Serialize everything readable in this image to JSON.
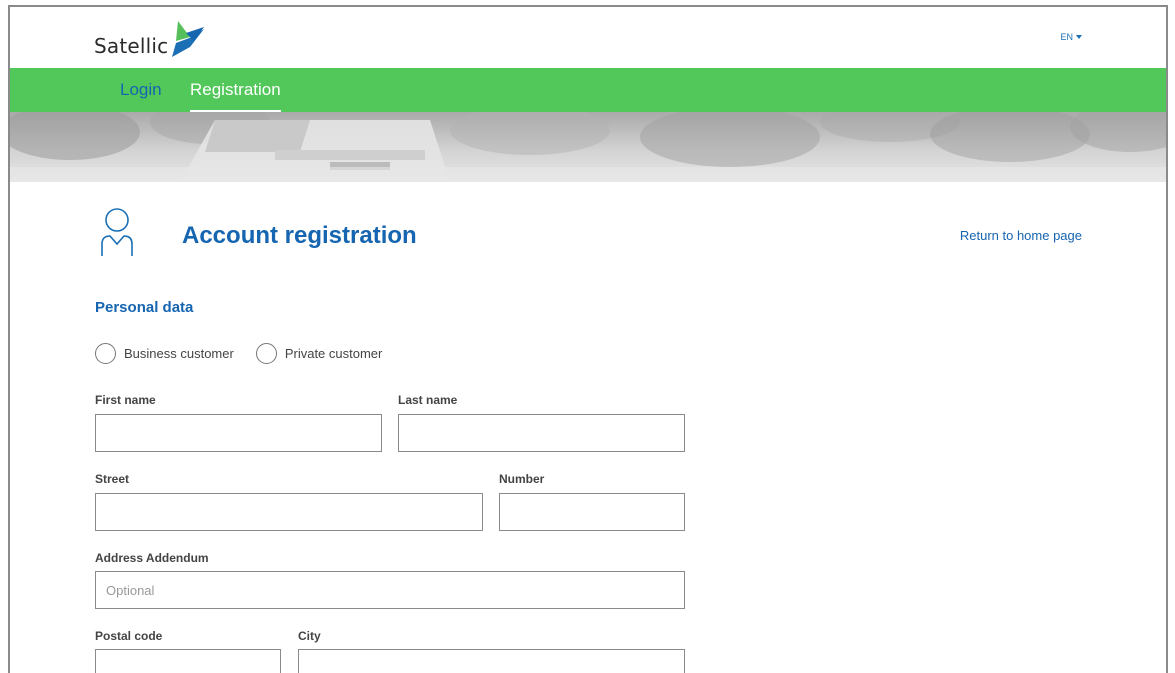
{
  "header": {
    "logo_text": "Satellic",
    "language": "EN"
  },
  "nav": {
    "login": "Login",
    "registration": "Registration"
  },
  "page": {
    "title": "Account registration",
    "return_link": "Return to home page"
  },
  "personal_data": {
    "section_title": "Personal data",
    "customer_type": {
      "business": "Business customer",
      "private": "Private customer"
    },
    "fields": {
      "first_name": {
        "label": "First name",
        "value": "",
        "placeholder": ""
      },
      "last_name": {
        "label": "Last name",
        "value": "",
        "placeholder": ""
      },
      "street": {
        "label": "Street",
        "value": "",
        "placeholder": ""
      },
      "number": {
        "label": "Number",
        "value": "",
        "placeholder": ""
      },
      "address_addendum": {
        "label": "Address Addendum",
        "value": "",
        "placeholder": "Optional"
      },
      "postal_code": {
        "label": "Postal code",
        "value": "",
        "placeholder": ""
      },
      "city": {
        "label": "City",
        "value": "",
        "placeholder": ""
      }
    }
  },
  "colors": {
    "nav_green": "#53c85a",
    "brand_blue": "#1565b0"
  },
  "icons": {
    "logo": "satellic-arrow-logo",
    "language_caret": "caret-down-icon",
    "user": "user-icon"
  }
}
